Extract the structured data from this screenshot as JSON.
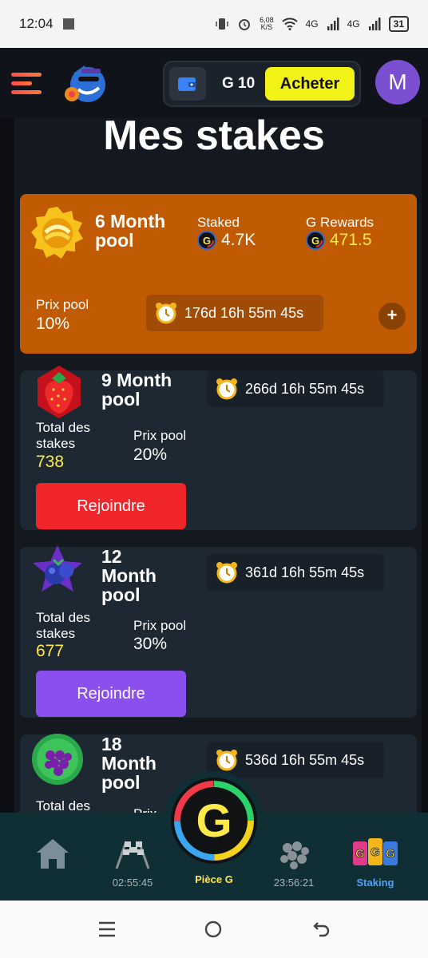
{
  "status_bar": {
    "time": "12:04",
    "speed_value": "6,08",
    "speed_unit": "K/S",
    "net1": "4G",
    "net2": "4G",
    "battery": "31"
  },
  "header": {
    "balance": "G 10",
    "buy_label": "Acheter",
    "avatar_initial": "M"
  },
  "page_title": "Mes stakes",
  "pools": [
    {
      "name_l1": "6 Month",
      "name_l2": "pool",
      "staked_label": "Staked",
      "staked_value": "4.7K",
      "rewards_label": "G Rewards",
      "rewards_value": "471.5",
      "prize_label": "Prix pool",
      "prize_value": "10%",
      "timer": "176d 16h 55m 45s",
      "plus": "+"
    },
    {
      "name_l1": "9 Month",
      "name_l2": "pool",
      "total_label_l1": "Total des",
      "total_label_l2": "stakes",
      "total_value": "738",
      "prize_label": "Prix pool",
      "prize_value": "20%",
      "timer": "266d 16h 55m 45s",
      "join_label": "Rejoindre",
      "join_color": "#f0262b"
    },
    {
      "name_l1": "12",
      "name_l2": "Month",
      "name_l3": "pool",
      "total_label_l1": "Total des",
      "total_label_l2": "stakes",
      "total_value": "677",
      "prize_label": "Prix pool",
      "prize_value": "30%",
      "timer": "361d 16h 55m 45s",
      "join_label": "Rejoindre",
      "join_color": "#8b4ff0"
    },
    {
      "name_l1": "18",
      "name_l2": "Month",
      "name_l3": "pool",
      "total_label_l1": "Total des",
      "prize_label_partial": "Prix",
      "timer": "536d 16h 55m 45s"
    }
  ],
  "bottom_nav": {
    "home": {
      "icon": "home-icon"
    },
    "race": {
      "icon": "checkered-flags-icon",
      "label": "02:55:45"
    },
    "center": {
      "icon": "g-coin-icon",
      "label": "Pièce G"
    },
    "grapes": {
      "icon": "grapes-icon",
      "label": "23:56:21"
    },
    "staking": {
      "icon": "ggg-cups-icon",
      "label": "Staking",
      "active_color": "#4da3ff"
    }
  },
  "system_nav": {
    "menu": "☰",
    "home": "○",
    "back": "↶"
  }
}
